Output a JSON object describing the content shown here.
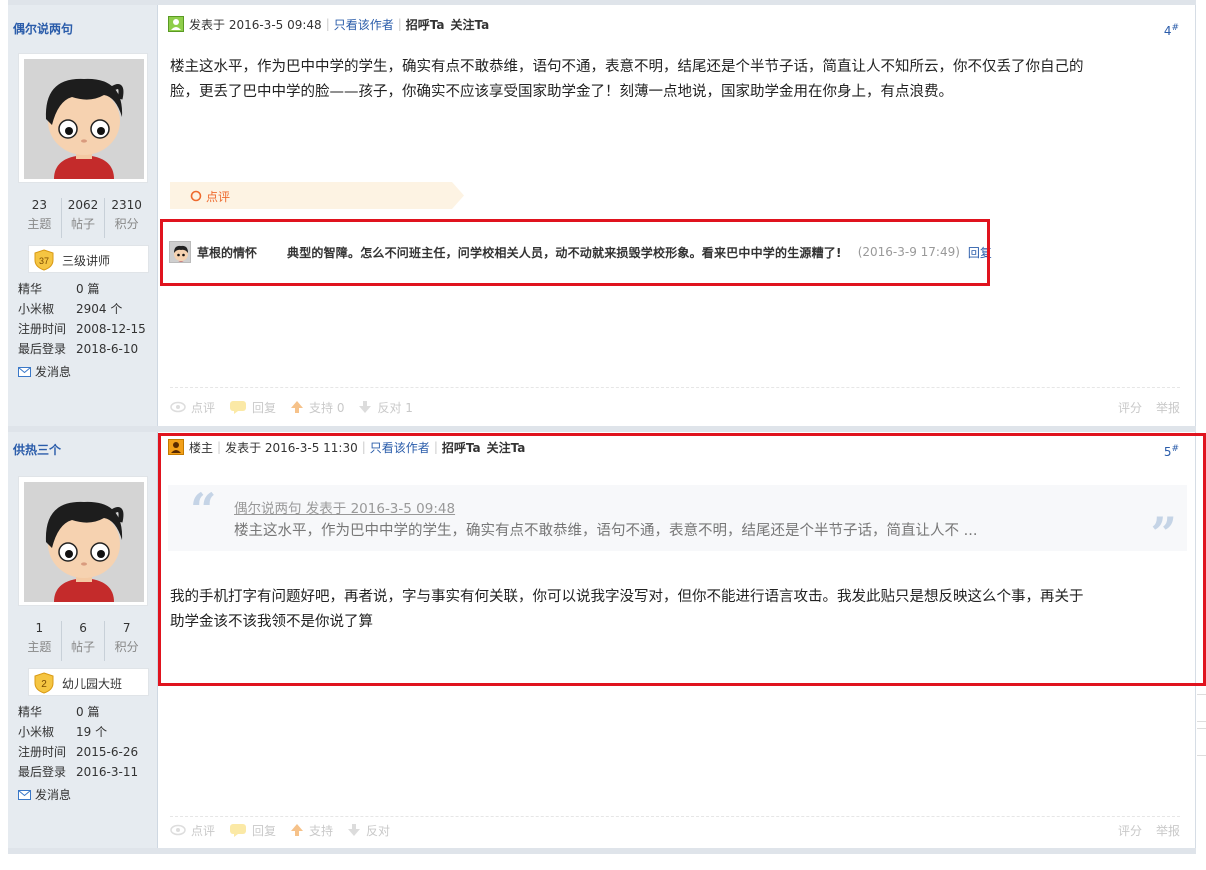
{
  "posts": [
    {
      "author": "偶尔说两句",
      "stats": [
        {
          "num": "23",
          "label": "主题"
        },
        {
          "num": "2062",
          "label": "帖子"
        },
        {
          "num": "2310",
          "label": "积分"
        }
      ],
      "rank": {
        "badge": "37",
        "title": "三级讲师"
      },
      "info": [
        {
          "k": "精华",
          "v": "0 篇"
        },
        {
          "k": "小米椒",
          "v": "2904 个"
        },
        {
          "k": "注册时间",
          "v": "2008-12-15"
        },
        {
          "k": "最后登录",
          "v": "2018-6-10"
        }
      ],
      "send_msg": "发消息",
      "posted": "发表于 2016-3-5 09:48",
      "only_author": "只看该作者",
      "greet": "招呼Ta",
      "follow": "关注Ta",
      "floor": "4",
      "floor_sup": "#",
      "content_line1": "楼主这水平，作为巴中中学的学生，确实有点不敢恭维，语句不通，表意不明，结尾还是个半节子话，简直让人不知所云，你不仅丢了你自己的",
      "content_line2": "脸，更丢了巴中中学的脸——孩子，你确实不应该享受国家助学金了！刻薄一点地说，国家助学金用在你身上，有点浪费。",
      "dianping_label": "点评",
      "comment": {
        "name": "草根的情怀",
        "text": "典型的智障。怎么不问班主任，问学校相关人员，动不动就来损毁学校形象。看来巴中中学的生源糟了!",
        "time": "(2016-3-9 17:49)",
        "reply": "回复"
      },
      "actions": {
        "comment": "点评",
        "reply": "回复",
        "support": "支持 0",
        "oppose": "反对 1",
        "rate": "评分",
        "report": "举报"
      }
    },
    {
      "author": "供热三个",
      "stats": [
        {
          "num": "1",
          "label": "主题"
        },
        {
          "num": "6",
          "label": "帖子"
        },
        {
          "num": "7",
          "label": "积分"
        }
      ],
      "rank": {
        "badge": "2",
        "title": "幼儿园大班"
      },
      "info": [
        {
          "k": "精华",
          "v": "0 篇"
        },
        {
          "k": "小米椒",
          "v": "19 个"
        },
        {
          "k": "注册时间",
          "v": "2015-6-26"
        },
        {
          "k": "最后登录",
          "v": "2016-3-11"
        }
      ],
      "send_msg": "发消息",
      "op_label": "楼主",
      "posted": "发表于 2016-3-5 11:30",
      "only_author": "只看该作者",
      "greet": "招呼Ta",
      "follow": "关注Ta",
      "floor": "5",
      "floor_sup": "#",
      "quote_meta": "偶尔说两句 发表于 2016-3-5 09:48",
      "quote_text": "楼主这水平，作为巴中中学的学生，确实有点不敢恭维，语句不通，表意不明，结尾还是个半节子话，简直让人不 ...",
      "content_line1": "我的手机打字有问题好吧，再者说，字与事实有何关联，你可以说我字没写对，但你不能进行语言攻击。我发此贴只是想反映这么个事，再关于",
      "content_line2": "助学金该不该我领不是你说了算",
      "actions": {
        "comment": "点评",
        "reply": "回复",
        "support": "支持",
        "oppose": "反对",
        "rate": "评分",
        "report": "举报"
      }
    }
  ],
  "colors": {
    "link": "#2a5caa",
    "highlight_box": "#e0131e",
    "sidebar": "#e6ebf0",
    "dianping": "#ee6a2e"
  }
}
